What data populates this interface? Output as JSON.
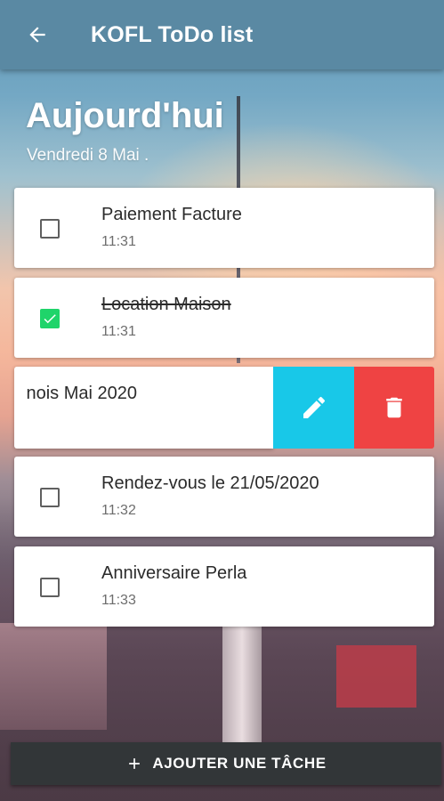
{
  "appbar": {
    "title": "KOFL ToDo list",
    "back_icon": "arrow-back-icon",
    "color": "#5a89a3"
  },
  "header": {
    "title": "Aujourd'hui",
    "date": "Vendredi 8 Mai ."
  },
  "tasks": [
    {
      "title": "Paiement Facture",
      "time": "11:31",
      "done": false
    },
    {
      "title": "Location Maison",
      "time": "11:31",
      "done": true
    },
    {
      "title": "nois Mai 2020",
      "time": "",
      "done": false,
      "swiped": true
    },
    {
      "title": "Rendez-vous le 21/05/2020",
      "time": "11:32",
      "done": false
    },
    {
      "title": "Anniversaire Perla",
      "time": "11:33",
      "done": false
    }
  ],
  "swipe_actions": {
    "edit_icon": "pencil-icon",
    "edit_color": "#18c8e8",
    "delete_icon": "trash-icon",
    "delete_color": "#ef4343"
  },
  "footer": {
    "add_label": "AJOUTER UNE TÂCHE",
    "add_icon": "plus-icon"
  },
  "colors": {
    "checked": "#1fd46a",
    "button_dark": "#323638"
  }
}
